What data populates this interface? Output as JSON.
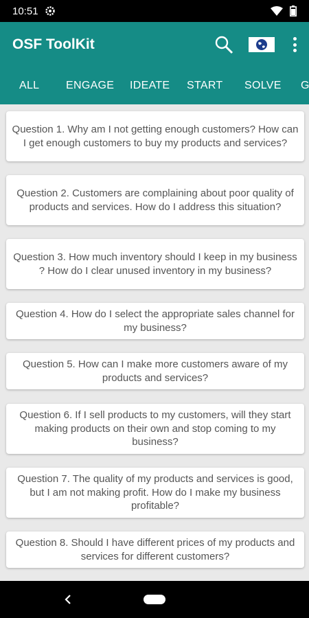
{
  "status": {
    "time": "10:51"
  },
  "app": {
    "title": "OSF ToolKit"
  },
  "tabs": [
    "ALL",
    "ENGAGE",
    "IDEATE",
    "START",
    "SOLVE",
    "G"
  ],
  "questions": [
    "Question 1. Why am I not getting enough customers? How can I get enough customers to buy my products and services?",
    "Question 2. Customers are complaining about poor quality of products and services. How do I address this situation?",
    "Question 3. How much inventory should I keep in my business ? How do I clear unused inventory in my business?",
    "Question 4. How do I select the appropriate sales channel for my business?",
    "Question 5. How can I make more customers aware of my products and services?",
    "Question 6. If I sell products to my customers, will they start making products on their own and stop coming to my business?",
    "Question 7. The quality of my products and services is good, but I am not making profit. How do I make my business profitable?",
    "Question 8. Should I have different prices of my products and services for different customers?"
  ],
  "colors": {
    "primary": "#158c86",
    "card_text": "#555555",
    "background": "#e9e9e9"
  },
  "icons": [
    "settings-icon",
    "wifi-icon",
    "battery-icon",
    "search-icon",
    "language-icon",
    "more-vert-icon",
    "back-icon",
    "home-icon"
  ]
}
